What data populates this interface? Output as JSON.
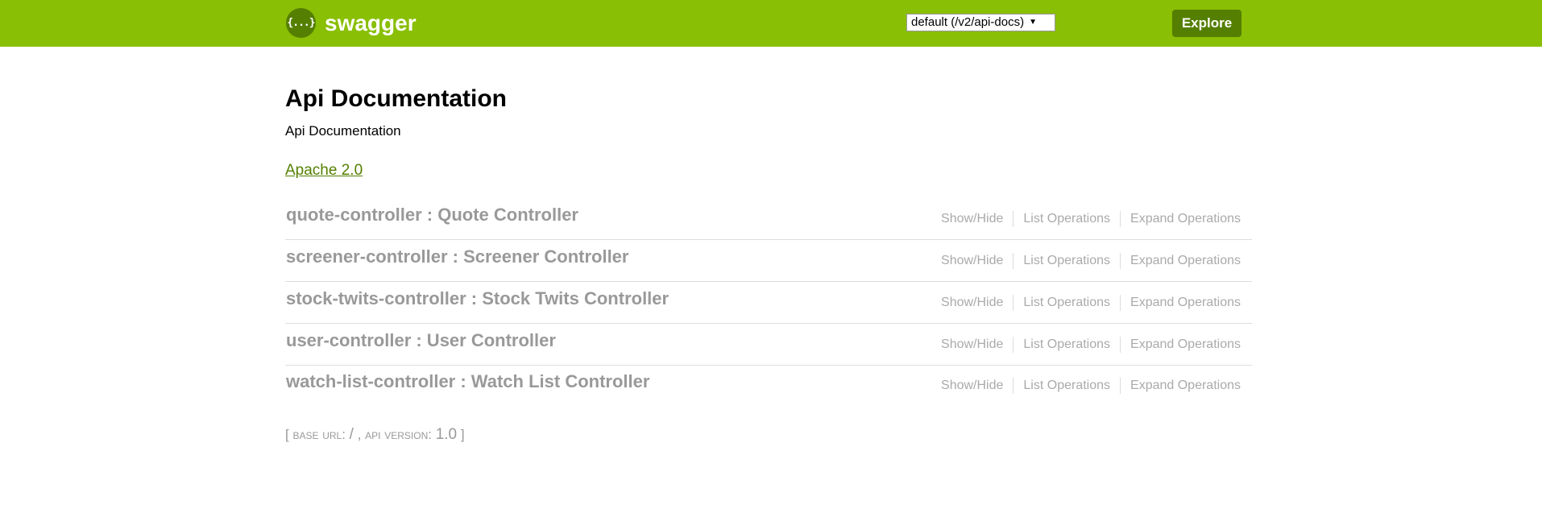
{
  "header": {
    "logo_icon": "{...}",
    "logo_text": "swagger",
    "api_select_value": "default (/v2/api-docs)",
    "explore_label": "Explore",
    "bg_color": "#89bf04",
    "accent_color": "#547f00"
  },
  "info": {
    "title": "Api Documentation",
    "description": "Api Documentation",
    "license": "Apache 2.0"
  },
  "resources": [
    {
      "name": "quote-controller : Quote Controller",
      "show_hide": "Show/Hide",
      "list_ops": "List Operations",
      "expand_ops": "Expand Operations"
    },
    {
      "name": "screener-controller : Screener Controller",
      "show_hide": "Show/Hide",
      "list_ops": "List Operations",
      "expand_ops": "Expand Operations"
    },
    {
      "name": "stock-twits-controller : Stock Twits Controller",
      "show_hide": "Show/Hide",
      "list_ops": "List Operations",
      "expand_ops": "Expand Operations"
    },
    {
      "name": "user-controller : User Controller",
      "show_hide": "Show/Hide",
      "list_ops": "List Operations",
      "expand_ops": "Expand Operations"
    },
    {
      "name": "watch-list-controller : Watch List Controller",
      "show_hide": "Show/Hide",
      "list_ops": "List Operations",
      "expand_ops": "Expand Operations"
    }
  ],
  "footer": {
    "open_bracket": "[",
    "base_url_label": "BASE URL:",
    "base_url_value": "/",
    "separator": ",",
    "api_version_label": "API VERSION:",
    "api_version_value": "1.0",
    "close_bracket": "]"
  }
}
